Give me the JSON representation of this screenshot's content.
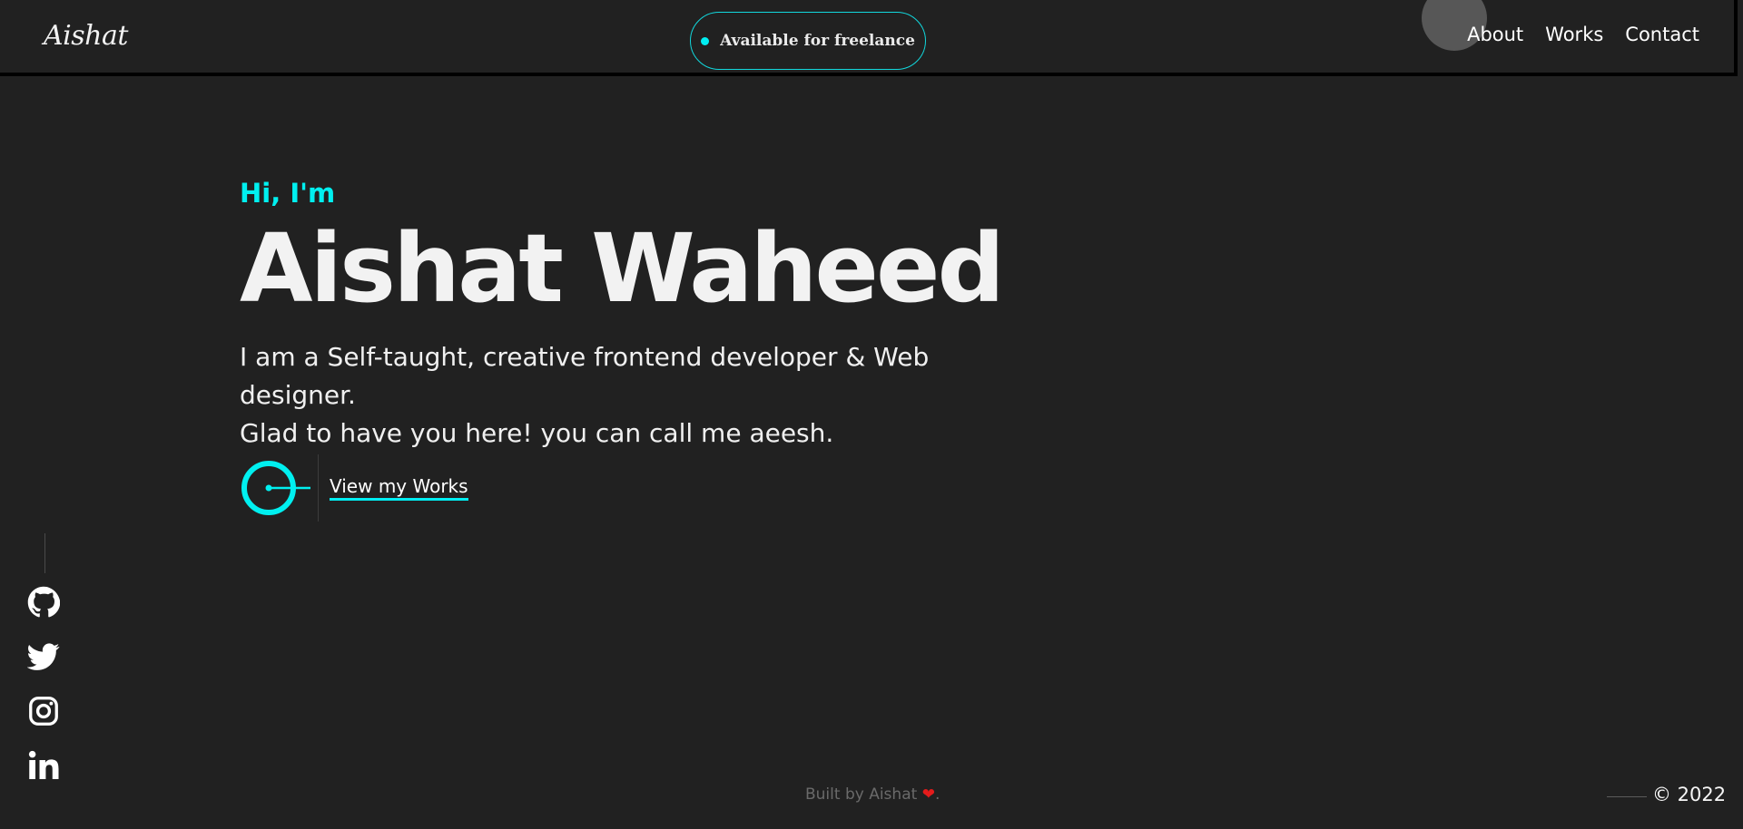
{
  "header": {
    "logo": "Aishat",
    "badge_text": "Available for freelance",
    "nav": [
      "About",
      "Works",
      "Contact"
    ]
  },
  "hero": {
    "greeting": "Hi, I'm",
    "name": "Aishat Waheed",
    "intro_line1": "I am a Self-taught, creative frontend developer & Web designer.",
    "intro_line2": "Glad to have you here! you can call me aeesh.",
    "cta_label": "View my Works"
  },
  "social": [
    "github-icon",
    "twitter-icon",
    "instagram-icon",
    "linkedin-icon"
  ],
  "footer": {
    "built_by": "Built by Aishat",
    "heart": "❤",
    "built_suffix": ".",
    "copyright": "© 2022"
  },
  "colors": {
    "background": "#212121",
    "accent": "#00f0f0",
    "text": "#f2f2f2",
    "heart": "#e41b1b"
  }
}
